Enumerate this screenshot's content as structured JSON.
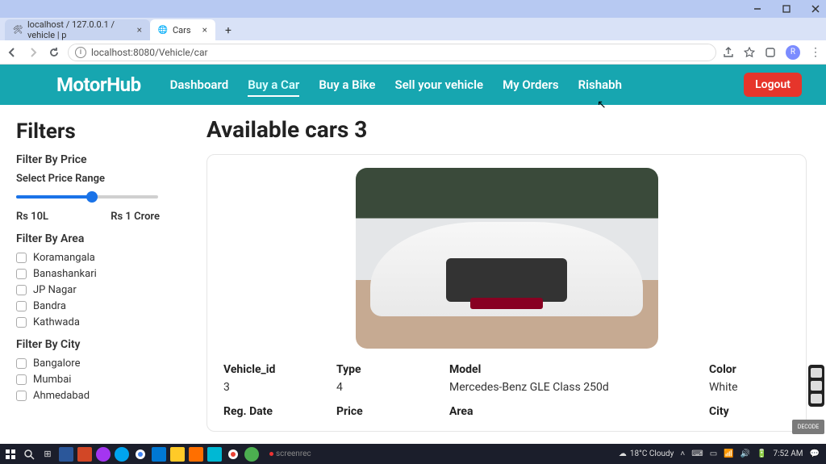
{
  "browser": {
    "tabs": [
      {
        "title": "localhost / 127.0.0.1 / vehicle | p",
        "favicon": "🛠"
      },
      {
        "title": "Cars",
        "favicon": "🌐"
      }
    ],
    "url": "localhost:8080/Vehicle/car"
  },
  "header": {
    "brand": "MotorHub",
    "nav": [
      "Dashboard",
      "Buy a Car",
      "Buy a Bike",
      "Sell your vehicle",
      "My Orders",
      "Rishabh"
    ],
    "active_nav": "Buy a Car",
    "logout": "Logout"
  },
  "filters": {
    "title": "Filters",
    "price_label": "Filter By Price",
    "range_label": "Select Price Range",
    "range_min": "Rs 10L",
    "range_max": "Rs 1 Crore",
    "area_label": "Filter By Area",
    "areas": [
      "Koramangala",
      "Banashankari",
      "JP Nagar",
      "Bandra",
      "Kathwada"
    ],
    "city_label": "Filter By City",
    "cities": [
      "Bangalore",
      "Mumbai",
      "Ahmedabad"
    ]
  },
  "main": {
    "heading": "Available cars 3",
    "spec_labels": {
      "vehicle_id": "Vehicle_id",
      "type": "Type",
      "model": "Model",
      "color": "Color",
      "reg_date": "Reg. Date",
      "price": "Price",
      "area": "Area",
      "city": "City"
    },
    "car": {
      "vehicle_id": "3",
      "type": "4",
      "model": "Mercedes-Benz GLE Class 250d",
      "color": "White"
    }
  },
  "taskbar": {
    "weather": "18°C Cloudy",
    "time": "7:52 AM",
    "screenrec": "screenrec",
    "decode": "DECODE"
  }
}
